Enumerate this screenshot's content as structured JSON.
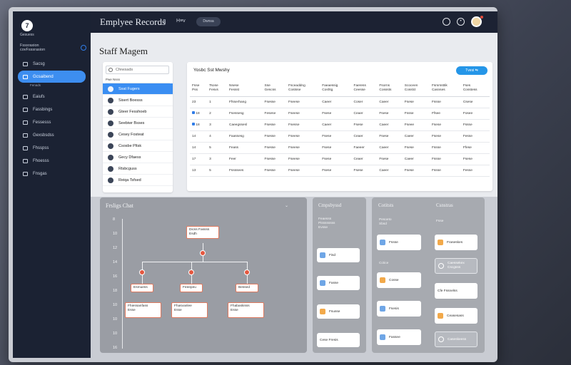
{
  "app": {
    "logo": "7",
    "logo_caption": "Gesuess",
    "title": "Emplyee Records",
    "topbar_number": "3",
    "topbar_help": "H≡v",
    "topbar_pill": "Dwnsa"
  },
  "sidebar": {
    "org": "Fsssraxion\ncovFsssrasion",
    "items": [
      {
        "label": "Sacsg",
        "sub": ""
      },
      {
        "label": "Gcsaibend",
        "sub": "Fenads",
        "active": true
      },
      {
        "label": "Eaiufs",
        "sub": ""
      },
      {
        "label": "Fassbings",
        "sub": ""
      },
      {
        "label": "Fessesss",
        "sub": ""
      },
      {
        "label": "Gexsbsdss",
        "sub": ""
      },
      {
        "label": "Fhsspss",
        "sub": ""
      },
      {
        "label": "Fhoesss",
        "sub": ""
      },
      {
        "label": "Fnsgas",
        "sub": ""
      }
    ]
  },
  "main": {
    "page_title": "Staff Magem",
    "search_placeholder": "Cfewsads",
    "list_header": "Pwe  Nsss",
    "employees": [
      {
        "name": "Sxat Fugers",
        "selected": true
      },
      {
        "name": "Sisert Boesss"
      },
      {
        "name": "Gteer Fesshoeb"
      },
      {
        "name": "Seebiwr Bsses"
      },
      {
        "name": "Cesey Fosteat"
      },
      {
        "name": "Csosbe Pltsk"
      },
      {
        "name": "Gecy Dfaess"
      },
      {
        "name": "Rtsbcguss"
      },
      {
        "name": "Reiqa Tsfsed"
      }
    ]
  },
  "table": {
    "title": "Yosbc Sst Mwshy",
    "add_button": "Tvesi ⇆",
    "headers": [
      "Fsse\nPss",
      "Tsose\nFesvs",
      "Nsese\nFessst",
      "Sse\nGescss",
      "Fsceaddng\nCostsse",
      "Faeaessig\nCoshtg",
      "Faeress\nCeesse",
      "Fsorns\nCosssts",
      "Scoceen\nCosslct",
      "Fsmrssttik\nCasnses",
      "Fses\nCosstess"
    ],
    "rows": [
      {
        "id": "23",
        "n": "1",
        "c": [
          "Ffsserhang",
          "Fsesse",
          "Fseese",
          "Caeer",
          "Coser",
          "Caeer",
          "Fsese",
          "Fssse",
          "Csese"
        ]
      },
      {
        "id": "18",
        "n": "2",
        "c": [
          "Fsessesg",
          "Fesese",
          "Fseese",
          "Fsese",
          "Ceaer",
          "Fsese",
          "Fssse",
          "Ffsee",
          "Fosee"
        ]
      },
      {
        "id": "18",
        "n": "3",
        "c": [
          "Caeegssesl",
          "Fsesse",
          "Fsesse",
          "Caeer",
          "Fsese",
          "Caeer",
          "Fseee",
          "Fsese",
          "Fssse"
        ]
      },
      {
        "id": "14",
        "n": "4",
        "c": [
          "Faassesg",
          "Fsesse",
          "Fseese",
          "Fsese",
          "Ceaer",
          "Fsese",
          "Caeer",
          "Fsese",
          "Fesse"
        ]
      },
      {
        "id": "14",
        "n": "5",
        "c": [
          "Feass",
          "Fsesse",
          "Fseese",
          "Fsese",
          "Faeeer",
          "Caeer",
          "Fsese",
          "Fssse",
          "Ffese"
        ]
      },
      {
        "id": "17",
        "n": "3",
        "c": [
          "Feer",
          "Fsesse",
          "Fseese",
          "Fsese",
          "Ceaer",
          "Fsese",
          "Caeer",
          "Fssse",
          "Fsese"
        ]
      },
      {
        "id": "13",
        "n": "5",
        "c": [
          "Fssssees",
          "Fsesse",
          "Fseese",
          "Fsese",
          "Fsese",
          "Caeer",
          "Fsese",
          "Fssse",
          "Fesse"
        ]
      }
    ],
    "flag_rows": [
      1,
      2
    ]
  },
  "org_chart": {
    "title": "Frsligs Chat",
    "control": "⌄",
    "y_ticks": [
      "8",
      "10",
      "12",
      "14",
      "16",
      "18",
      "10",
      "10",
      "10",
      "16"
    ],
    "root": {
      "line1": "Dicss Fassss",
      "line2": "Esdh"
    },
    "mid": [
      "Esmuess",
      "Feeepeu",
      "Bessed"
    ],
    "leaves": [
      {
        "line1": "Fhiessanfass",
        "line2": "Esse"
      },
      {
        "line1": "Fhasvanlee",
        "line2": "Esse"
      },
      {
        "line1": "Fhabaskisss",
        "line2": "Esse"
      }
    ]
  },
  "employees_panel": {
    "title": "Cmpsbyssd",
    "intro": "Feaesss\nPissssssss\nEvsse",
    "cards": [
      "Fisd",
      "Fasse",
      "Fsusse",
      "Cese Fresis"
    ]
  },
  "contacts_panel": {
    "title": "Cotitsts",
    "sub": "Pesoeto\nSbsd",
    "cards": [
      "Fssse",
      "Cosse",
      "Fsesis",
      "Fassee",
      "Fssse"
    ],
    "section": "Cctice"
  },
  "settings_panel": {
    "title": "Csnstras",
    "sub": "Fsse",
    "cards": [
      "Fraseskes",
      "Caessekex\nCscgsss",
      "Cfe Fssnelss",
      "Ceasesass",
      "Caseskeess"
    ]
  }
}
